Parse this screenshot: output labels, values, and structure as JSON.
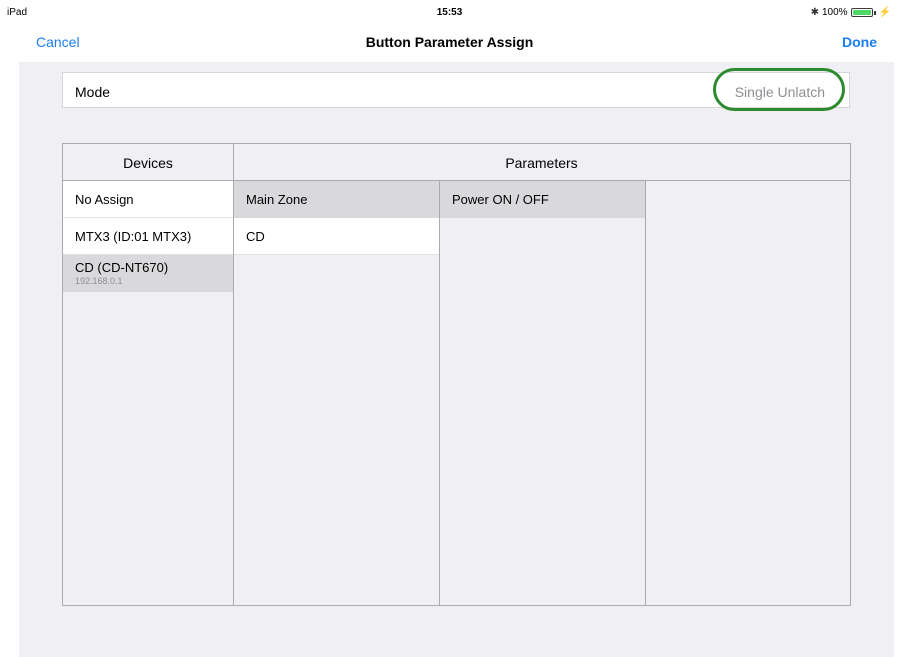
{
  "status_bar": {
    "device": "iPad",
    "time": "15:53",
    "battery": "100%",
    "battery_level": 1.0,
    "bluetooth_icon": "bluetooth-icon",
    "charging_icon": "charging-icon"
  },
  "nav": {
    "cancel": "Cancel",
    "title": "Button Parameter Assign",
    "done": "Done"
  },
  "mode": {
    "label": "Mode",
    "value": "Single Unlatch"
  },
  "table": {
    "devices_header": "Devices",
    "parameters_header": "Parameters",
    "devices": [
      {
        "name": "No Assign",
        "sub": ""
      },
      {
        "name": "MTX3 (ID:01 MTX3)",
        "sub": ""
      },
      {
        "name": "CD (CD-NT670)",
        "sub": "192.168.0.1"
      }
    ],
    "zones": [
      {
        "name": "Main Zone"
      },
      {
        "name": "CD"
      }
    ],
    "parameters": [
      {
        "name": "Power ON / OFF"
      }
    ]
  },
  "colors": {
    "accent": "#1c7ef0",
    "highlight_ring": "#2f8a2f",
    "selected_row": "#d9d9dc",
    "background": "#efeff4"
  }
}
